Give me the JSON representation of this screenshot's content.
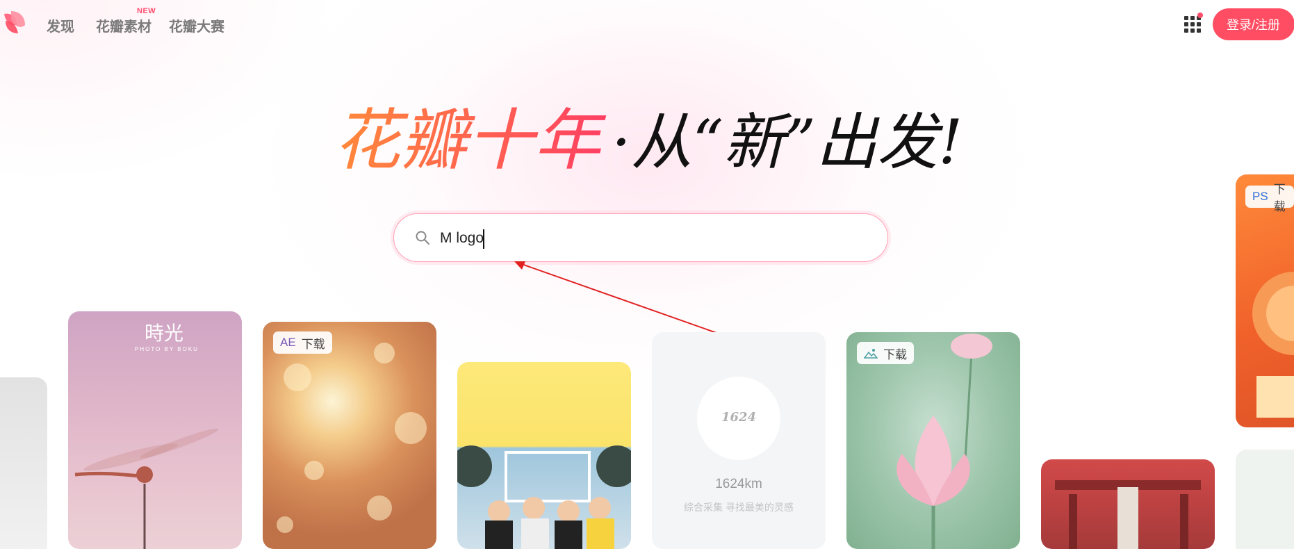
{
  "nav": {
    "discover": "发现",
    "materials": "花瓣素材",
    "materials_badge": "NEW",
    "contest": "花瓣大赛"
  },
  "header": {
    "login_label": "登录/注册"
  },
  "hero": {
    "headline_colored": "花瓣十年",
    "headline_dark": "·从“新”出发!"
  },
  "search": {
    "value": "M logo"
  },
  "cards": {
    "dragonfly": {
      "title": "時光",
      "credit": "PHOTO BY BOKU"
    },
    "bokeh": {
      "type": "AE",
      "action": "下载"
    },
    "profile": {
      "logo_text": "1624",
      "name": "1624km",
      "desc": "综合采集 寻找最美的灵感"
    },
    "lotus": {
      "action": "下载"
    },
    "orange": {
      "type": "PS",
      "action": "下载"
    }
  },
  "colors": {
    "brand": "#ff4d63",
    "annotation_arrow": "#e02020"
  },
  "icons": {
    "logo": "petal-logo-icon",
    "apps": "apps-grid-icon",
    "search": "search-icon",
    "image": "image-icon"
  }
}
